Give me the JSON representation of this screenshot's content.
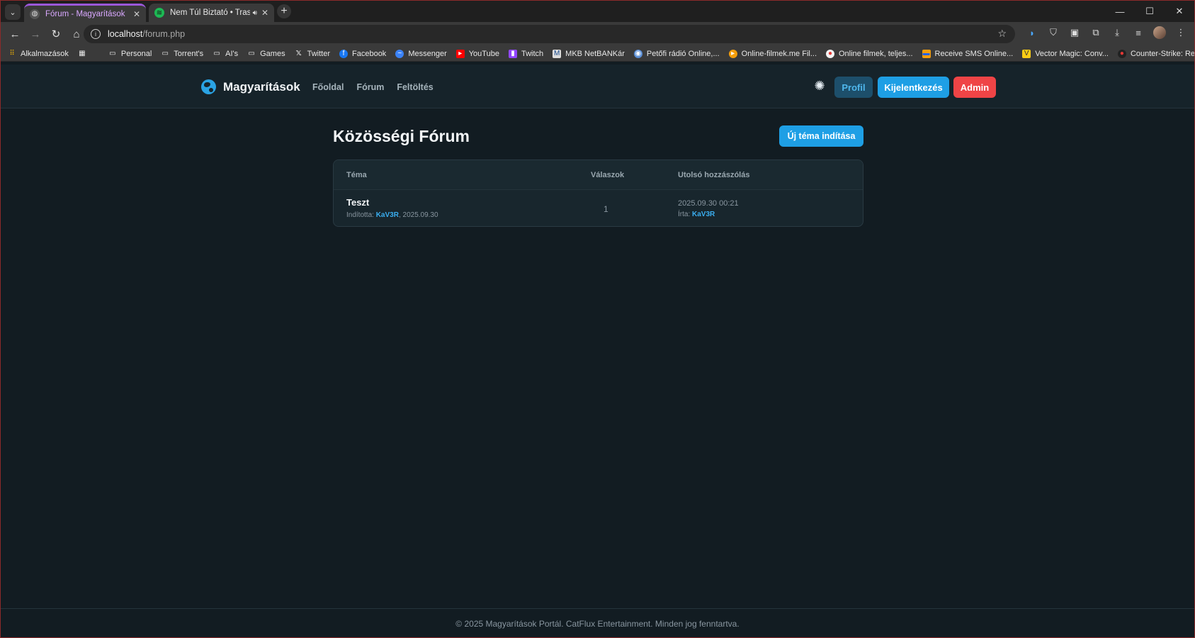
{
  "browser": {
    "tabs": [
      {
        "title": "Fórum - Magyarítások",
        "active": true
      },
      {
        "title": "Nem Túl Biztató • Trashkat",
        "active": false
      }
    ],
    "url_host": "localhost",
    "url_path": "/forum.php",
    "bookmarks": [
      {
        "label": "Alkalmazások",
        "icon": "apps-grid-icon"
      },
      {
        "label": "Personal",
        "icon": "folder-icon"
      },
      {
        "label": "Torrent's",
        "icon": "folder-icon"
      },
      {
        "label": "AI's",
        "icon": "folder-icon"
      },
      {
        "label": "Games",
        "icon": "folder-icon"
      },
      {
        "label": "Twitter",
        "icon": "x-logo-icon"
      },
      {
        "label": "Facebook",
        "icon": "facebook-icon"
      },
      {
        "label": "Messenger",
        "icon": "messenger-icon"
      },
      {
        "label": "YouTube",
        "icon": "youtube-icon"
      },
      {
        "label": "Twitch",
        "icon": "twitch-icon"
      },
      {
        "label": "MKB NetBANKár",
        "icon": "bank-icon"
      },
      {
        "label": "Petőfi rádió Online,...",
        "icon": "radio-icon"
      },
      {
        "label": "Online-filmek.me Fil...",
        "icon": "play-icon"
      },
      {
        "label": "Online filmek, teljes...",
        "icon": "film-icon"
      },
      {
        "label": "Receive SMS Online...",
        "icon": "sms-icon"
      },
      {
        "label": "Vector Magic: Conv...",
        "icon": "vector-icon"
      },
      {
        "label": "Counter-Strike: Rest...",
        "icon": "cs-icon"
      }
    ]
  },
  "site": {
    "brand": "Magyarítások",
    "nav": [
      "Főoldal",
      "Fórum",
      "Feltöltés"
    ],
    "buttons": {
      "profile": "Profil",
      "logout": "Kijelentkezés",
      "admin": "Admin"
    },
    "colors": {
      "accent": "#1e9fe5",
      "danger": "#ef4446",
      "background": "#121c22"
    }
  },
  "main": {
    "title": "Közösségi Fórum",
    "new_topic": "Új téma indítása",
    "columns": {
      "topic": "Téma",
      "replies": "Válaszok",
      "last_post": "Utolsó hozzászólás"
    },
    "topics": [
      {
        "title": "Teszt",
        "started_prefix": "Indította:",
        "author": "KaV3R",
        "started_date": ", 2025.09.30",
        "replies": "1",
        "last_date": "2025.09.30 00:21",
        "last_by_prefix": "Írta:",
        "last_author": "KaV3R"
      }
    ]
  },
  "footer": {
    "text": "© 2025 Magyarítások Portál. CatFlux Entertainment. Minden jog fenntartva."
  }
}
